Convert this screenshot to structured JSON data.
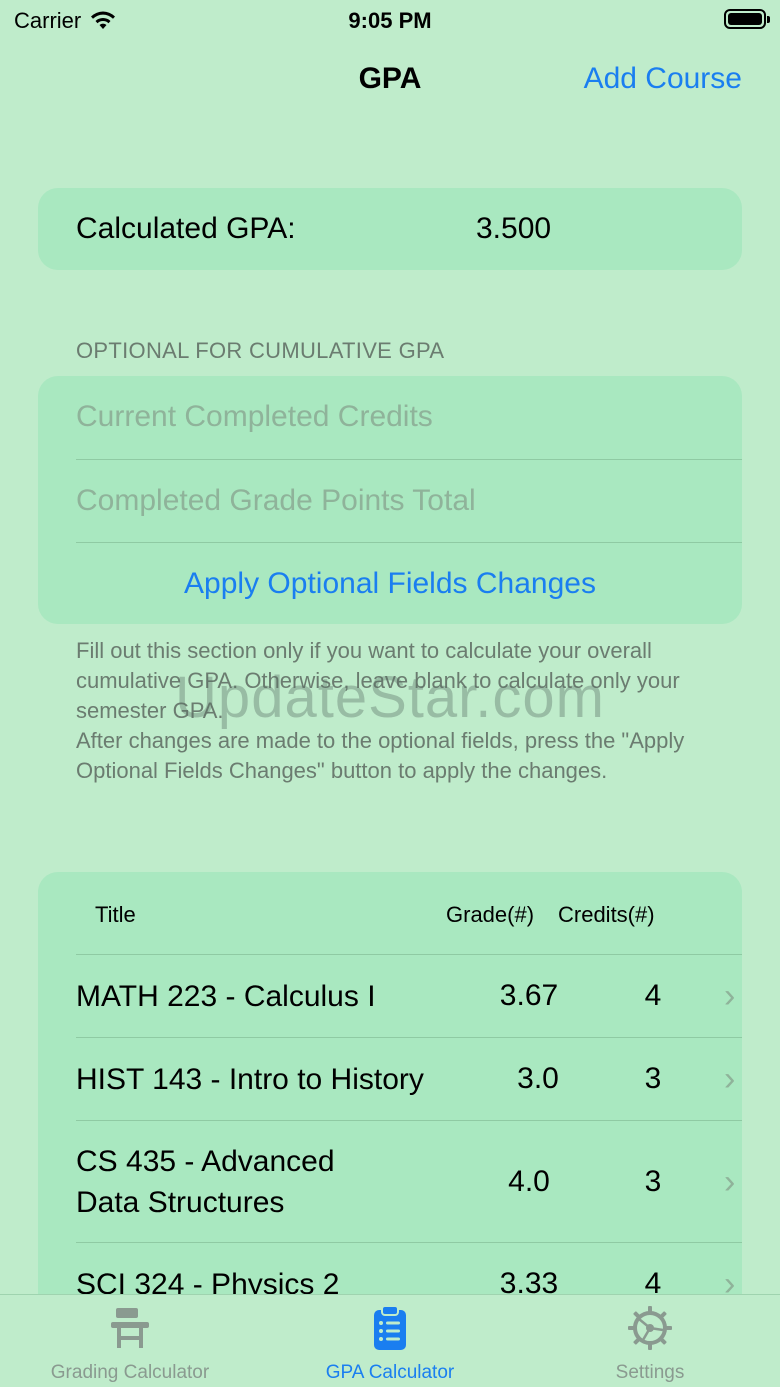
{
  "status_bar": {
    "carrier": "Carrier",
    "time": "9:05 PM"
  },
  "nav": {
    "title": "GPA",
    "action": "Add Course"
  },
  "gpa": {
    "label": "Calculated GPA:",
    "value": "3.500"
  },
  "optional": {
    "header": "OPTIONAL FOR CUMULATIVE GPA",
    "credits_placeholder": "Current Completed Credits",
    "points_placeholder": "Completed Grade Points Total",
    "credits_value": "",
    "points_value": "",
    "apply_label": "Apply Optional Fields Changes",
    "footer_line1": "Fill out this section only if you want to calculate your overall cumulative GPA. Otherwise, leave blank to calculate only your semester GPA.",
    "footer_line2": "After changes are made to the optional fields, press the \"Apply Optional Fields Changes\" button to apply the changes."
  },
  "watermark": "UpdateStar.com",
  "courses": {
    "headers": {
      "title": "Title",
      "grade": "Grade(#)",
      "credits": "Credits(#)"
    },
    "rows": [
      {
        "title": "MATH 223 - Calculus I",
        "grade": "3.67",
        "credits": "4"
      },
      {
        "title": "HIST 143 - Intro to History",
        "grade": "3.0",
        "credits": "3"
      },
      {
        "title": "CS 435 - Advanced Data Structures",
        "grade": "4.0",
        "credits": "3"
      },
      {
        "title": "SCI 324 - Physics 2",
        "grade": "3.33",
        "credits": "4"
      }
    ]
  },
  "tabs": [
    {
      "label": "Grading Calculator",
      "icon": "school-desk-icon",
      "active": false
    },
    {
      "label": "GPA Calculator",
      "icon": "clipboard-list-icon",
      "active": true
    },
    {
      "label": "Settings",
      "icon": "gear-icon",
      "active": false
    }
  ],
  "colors": {
    "accent": "#1a7ef0",
    "background": "#bfeccb",
    "card": "#a9e8c0",
    "muted": "#6b7c70"
  }
}
